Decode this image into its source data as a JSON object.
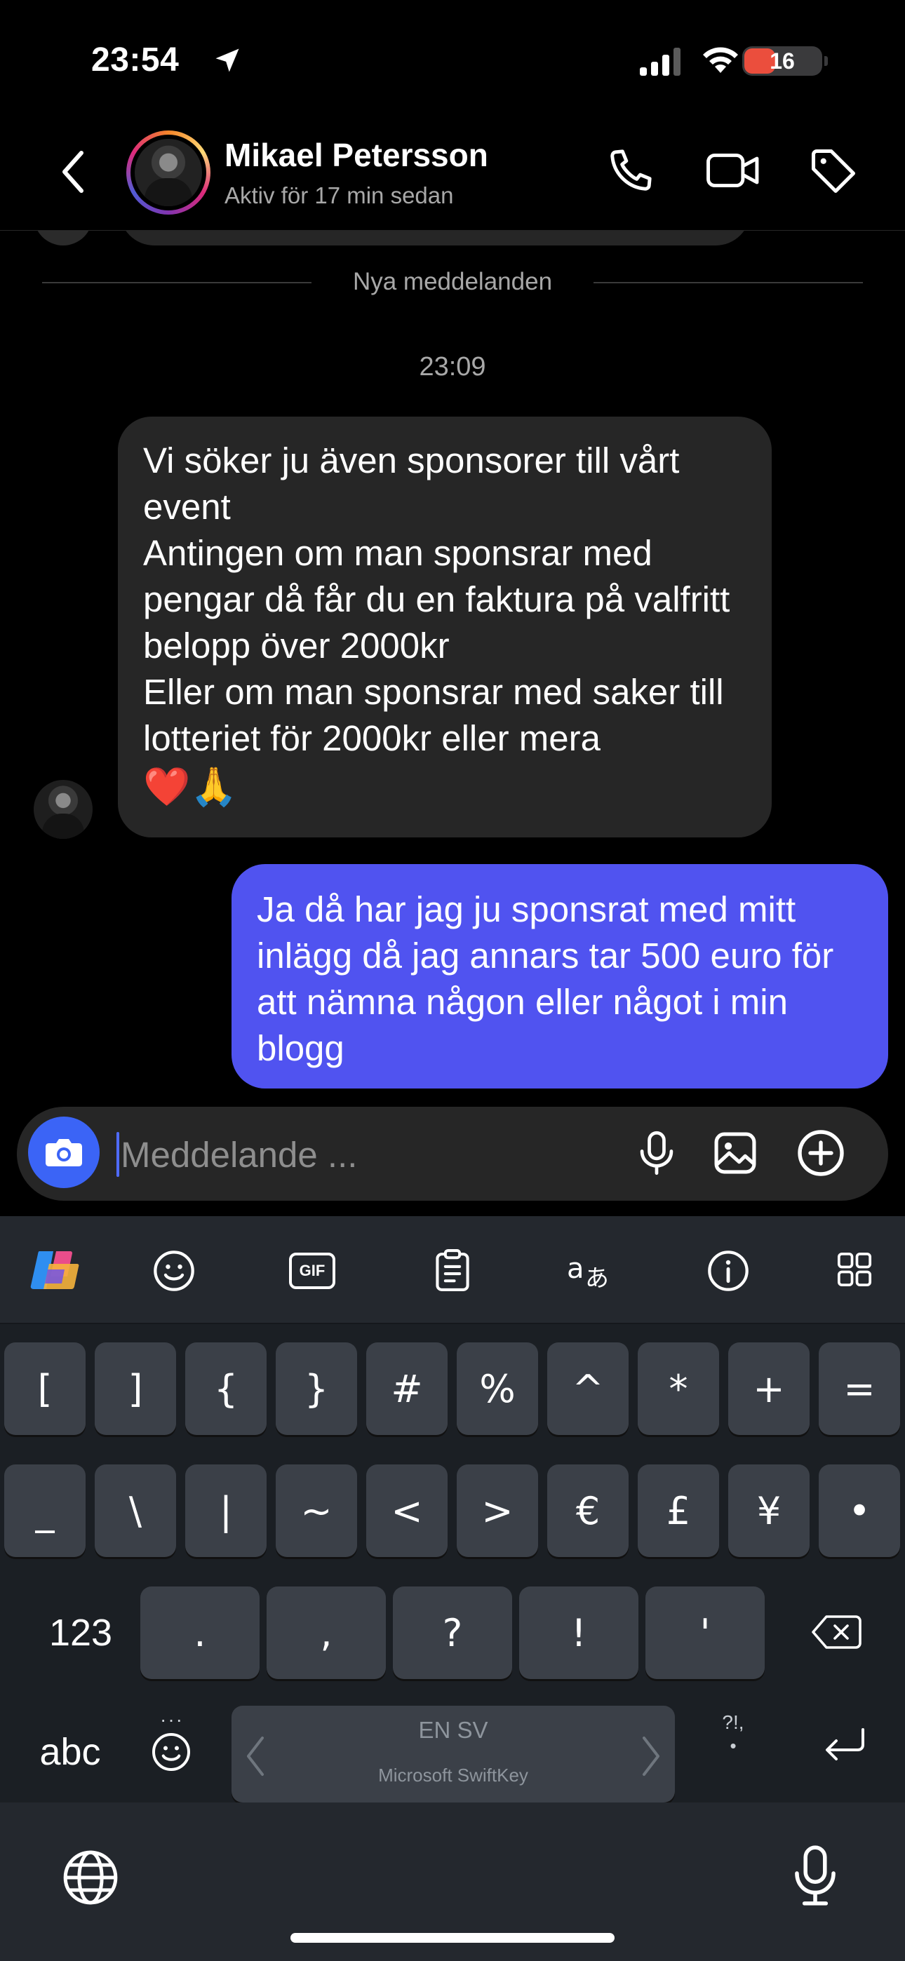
{
  "status_bar": {
    "time": "23:54",
    "battery_level": "16",
    "battery_color": "#eb4e3d"
  },
  "header": {
    "contact_name": "Mikael Petersson",
    "contact_status": "Aktiv för 17 min sedan"
  },
  "chat": {
    "divider_label": "Nya meddelanden",
    "timestamp": "23:09",
    "incoming": {
      "lines": [
        "Vi söker ju även sponsorer till vårt event",
        "Antingen om man sponsrar med pengar då får du en faktura på valfritt belopp över 2000kr",
        "Eller om man sponsrar med saker till lotteriet för 2000kr eller mera"
      ],
      "emoji": "❤️🙏"
    },
    "outgoing": {
      "text": "Ja då har jag ju sponsrat med mitt inlägg då jag annars tar 500 euro för att nämna någon eller något i min blogg",
      "color": "#5053f0"
    }
  },
  "composer": {
    "placeholder": "Meddelande ..."
  },
  "keyboard": {
    "row1": [
      "[",
      "]",
      "{",
      "}",
      "#",
      "%",
      "^",
      "*",
      "+",
      "="
    ],
    "row2": [
      "_",
      "\\",
      "|",
      "~",
      "<",
      ">",
      "€",
      "£",
      "¥",
      "•"
    ],
    "row3": [
      ".",
      ",",
      "?",
      "!",
      "'"
    ],
    "numbers_label": "123",
    "abc_label": "abc",
    "ellipsis": "···",
    "punct_label": "?!,",
    "punct_dot": "•",
    "space_languages": "EN SV",
    "space_brand": "Microsoft SwiftKey",
    "gif_label": "GIF"
  }
}
